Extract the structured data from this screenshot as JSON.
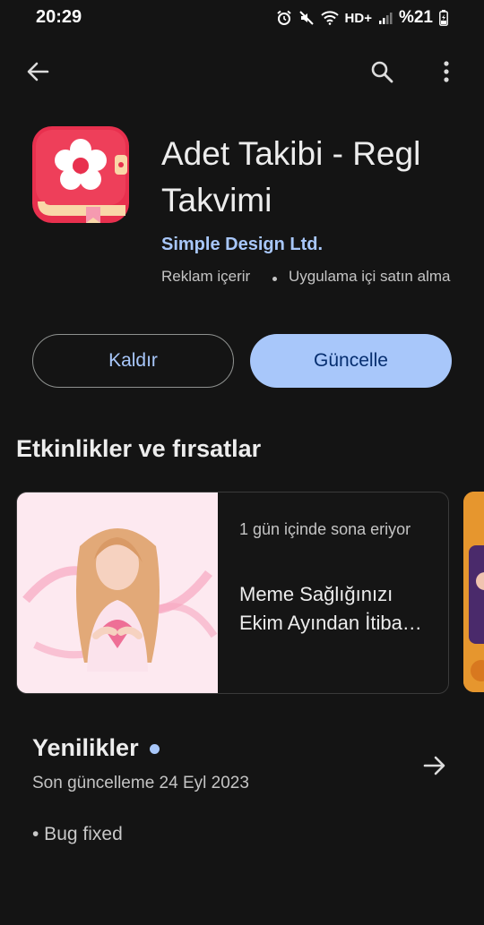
{
  "status_bar": {
    "time": "20:29",
    "network_label": "HD+",
    "battery": "%21",
    "icons": [
      "alarm-icon",
      "mute-icon",
      "wifi-icon",
      "signal-icon",
      "battery-icon"
    ]
  },
  "app_bar": {
    "icons": [
      "back-arrow-icon",
      "search-icon",
      "more-vert-icon"
    ]
  },
  "app": {
    "title": "Adet Takibi - Regl Takvimi",
    "developer": "Simple Design Ltd.",
    "meta_ads": "Reklam içerir",
    "meta_iap": "Uygulama içi satın alma",
    "icon": "flower-calendar-app-icon",
    "icon_colors": {
      "background": "#e8304e",
      "flower": "#ffffff",
      "flower_center": "#e8304e",
      "page": "#f9d7a8"
    }
  },
  "buttons": {
    "uninstall": "Kaldır",
    "update": "Güncelle"
  },
  "events": {
    "title": "Etkinlikler ve fırsatlar",
    "cards": [
      {
        "expires": "1 gün içinde sona eriyor",
        "text": "Meme Sağlığınızı Ekim Ayından İtiba…",
        "image": "woman-holding-heart-illustration"
      }
    ]
  },
  "whats_new": {
    "title": "Yenilikler",
    "last_updated": "Son güncelleme 24 Eyl 2023",
    "changelog": "• Bug fixed"
  },
  "colors": {
    "background": "#141414",
    "accent": "#a8c7fa",
    "accent_text": "#062e6f"
  }
}
